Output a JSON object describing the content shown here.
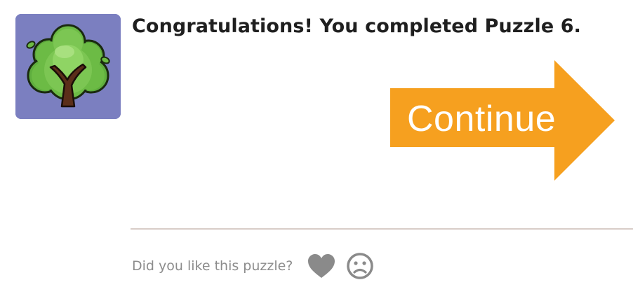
{
  "puzzle_complete": {
    "message": "Congratulations! You completed Puzzle 6.",
    "badge_icon": "tree-icon",
    "colors": {
      "badge_background": "#7b7fc0",
      "accent": "#f6a01f",
      "divider": "#d8cdc8"
    }
  },
  "continue_button": {
    "label": "Continue",
    "icon": "arrow-right-icon"
  },
  "feedback": {
    "prompt": "Did you like this puzzle?",
    "like_icon": "heart-icon",
    "dislike_icon": "sad-face-icon",
    "icon_color": "#8a8a8a"
  }
}
